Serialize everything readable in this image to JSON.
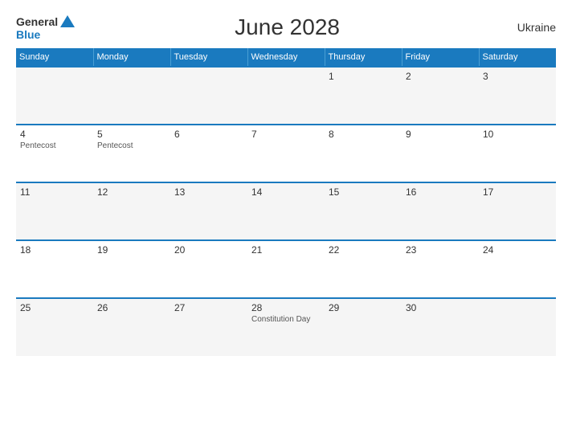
{
  "header": {
    "logo_general": "General",
    "logo_blue": "Blue",
    "title": "June 2028",
    "country": "Ukraine"
  },
  "weekdays": [
    "Sunday",
    "Monday",
    "Tuesday",
    "Wednesday",
    "Thursday",
    "Friday",
    "Saturday"
  ],
  "weeks": [
    [
      {
        "day": "",
        "event": ""
      },
      {
        "day": "",
        "event": ""
      },
      {
        "day": "",
        "event": ""
      },
      {
        "day": "",
        "event": ""
      },
      {
        "day": "1",
        "event": ""
      },
      {
        "day": "2",
        "event": ""
      },
      {
        "day": "3",
        "event": ""
      }
    ],
    [
      {
        "day": "4",
        "event": "Pentecost"
      },
      {
        "day": "5",
        "event": "Pentecost"
      },
      {
        "day": "6",
        "event": ""
      },
      {
        "day": "7",
        "event": ""
      },
      {
        "day": "8",
        "event": ""
      },
      {
        "day": "9",
        "event": ""
      },
      {
        "day": "10",
        "event": ""
      }
    ],
    [
      {
        "day": "11",
        "event": ""
      },
      {
        "day": "12",
        "event": ""
      },
      {
        "day": "13",
        "event": ""
      },
      {
        "day": "14",
        "event": ""
      },
      {
        "day": "15",
        "event": ""
      },
      {
        "day": "16",
        "event": ""
      },
      {
        "day": "17",
        "event": ""
      }
    ],
    [
      {
        "day": "18",
        "event": ""
      },
      {
        "day": "19",
        "event": ""
      },
      {
        "day": "20",
        "event": ""
      },
      {
        "day": "21",
        "event": ""
      },
      {
        "day": "22",
        "event": ""
      },
      {
        "day": "23",
        "event": ""
      },
      {
        "day": "24",
        "event": ""
      }
    ],
    [
      {
        "day": "25",
        "event": ""
      },
      {
        "day": "26",
        "event": ""
      },
      {
        "day": "27",
        "event": ""
      },
      {
        "day": "28",
        "event": "Constitution Day"
      },
      {
        "day": "29",
        "event": ""
      },
      {
        "day": "30",
        "event": ""
      },
      {
        "day": "",
        "event": ""
      }
    ]
  ]
}
